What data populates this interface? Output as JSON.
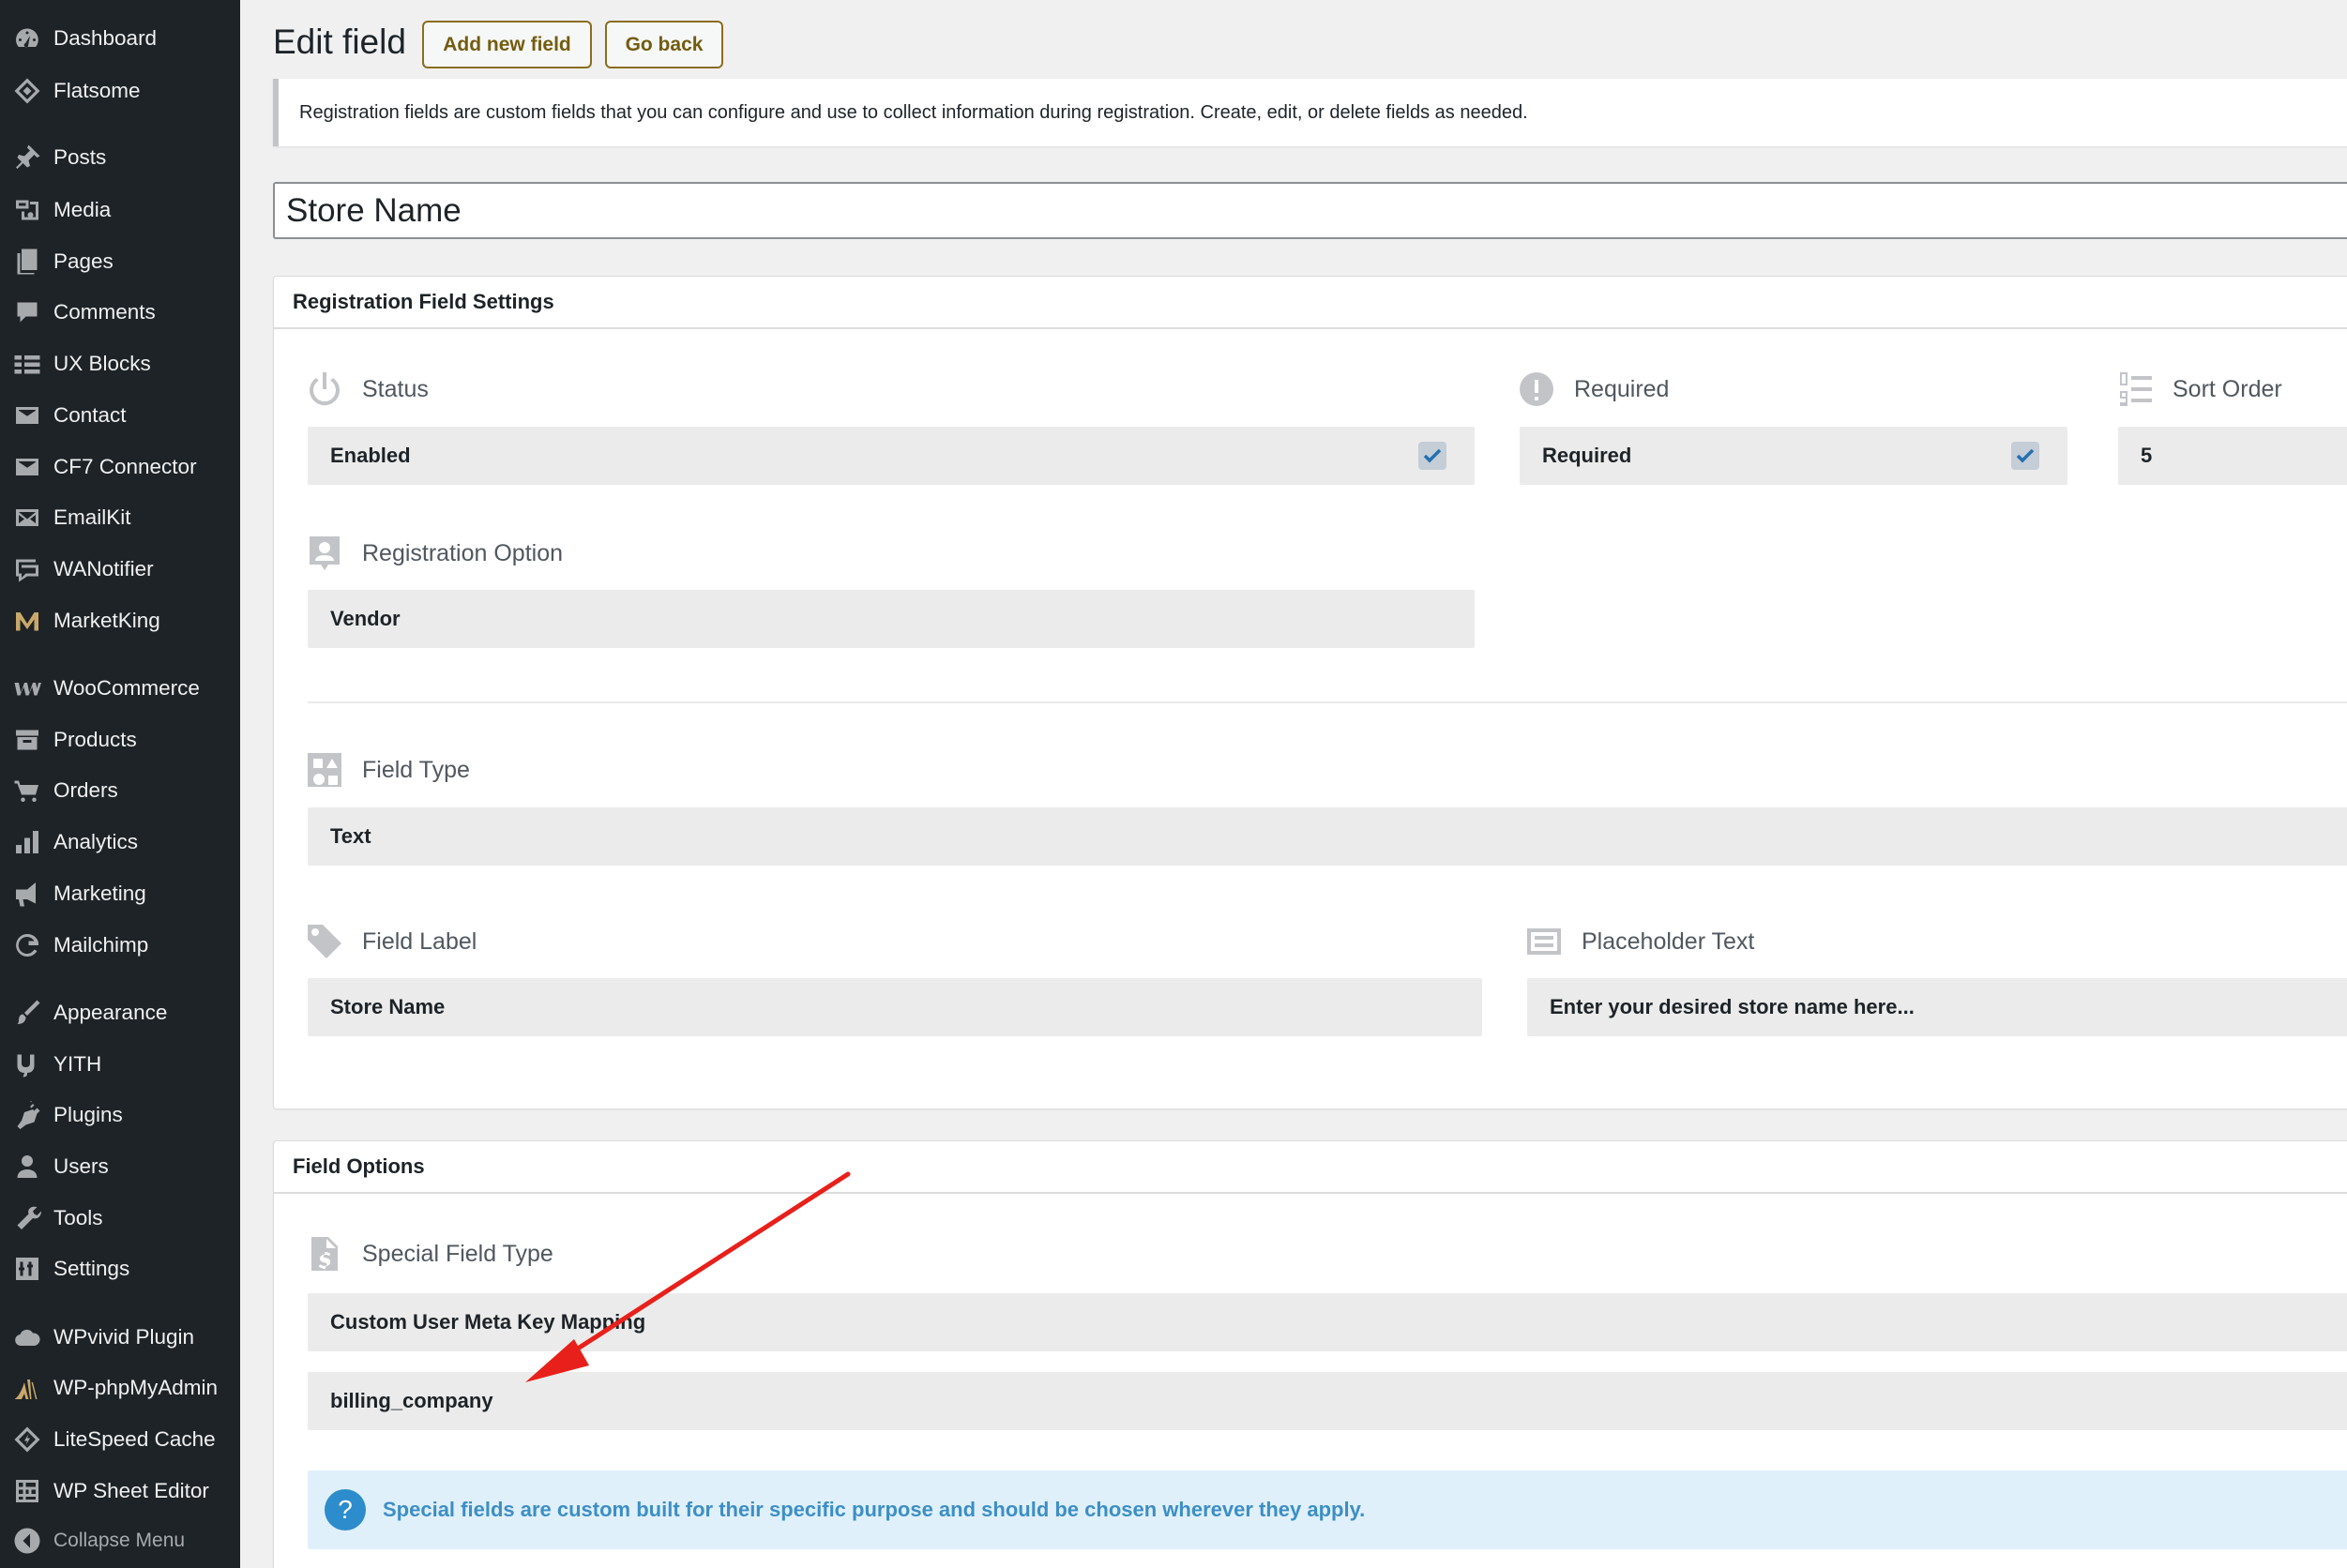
{
  "sidebar": {
    "items": [
      {
        "label": "Dashboard",
        "icon": "dashboard-icon"
      },
      {
        "label": "Flatsome",
        "icon": "flatsome-icon"
      },
      {
        "label": "Posts",
        "icon": "pin-icon"
      },
      {
        "label": "Media",
        "icon": "media-icon"
      },
      {
        "label": "Pages",
        "icon": "pages-icon"
      },
      {
        "label": "Comments",
        "icon": "comment-icon"
      },
      {
        "label": "UX Blocks",
        "icon": "ux-blocks-icon"
      },
      {
        "label": "Contact",
        "icon": "mail-icon"
      },
      {
        "label": "CF7 Connector",
        "icon": "mail-icon"
      },
      {
        "label": "EmailKit",
        "icon": "emailkit-icon"
      },
      {
        "label": "WANotifier",
        "icon": "chat-icon"
      },
      {
        "label": "MarketKing",
        "icon": "marketking-icon"
      },
      {
        "label": "WooCommerce",
        "icon": "woocommerce-icon"
      },
      {
        "label": "Products",
        "icon": "archive-icon"
      },
      {
        "label": "Orders",
        "icon": "cart-icon"
      },
      {
        "label": "Analytics",
        "icon": "bar-chart-icon"
      },
      {
        "label": "Marketing",
        "icon": "megaphone-icon"
      },
      {
        "label": "Mailchimp",
        "icon": "mailchimp-icon"
      },
      {
        "label": "Appearance",
        "icon": "brush-icon"
      },
      {
        "label": "YITH",
        "icon": "yith-icon"
      },
      {
        "label": "Plugins",
        "icon": "plug-icon"
      },
      {
        "label": "Users",
        "icon": "user-icon"
      },
      {
        "label": "Tools",
        "icon": "wrench-icon"
      },
      {
        "label": "Settings",
        "icon": "settings-icon"
      },
      {
        "label": "WPvivid Plugin",
        "icon": "cloud-icon"
      },
      {
        "label": "WP-phpMyAdmin",
        "icon": "phpmyadmin-icon"
      },
      {
        "label": "LiteSpeed Cache",
        "icon": "litespeed-icon"
      },
      {
        "label": "WP Sheet Editor",
        "icon": "sheet-icon"
      },
      {
        "label": "Collapse Menu",
        "icon": "collapse-icon"
      }
    ]
  },
  "header": {
    "title": "Edit field",
    "add_new_label": "Add new field",
    "go_back_label": "Go back"
  },
  "notice": {
    "text": "Registration fields are custom fields that you can configure and use to collect information during registration. Create, edit, or delete fields as needed."
  },
  "field_title": "Store Name",
  "settings_panel": {
    "title": "Registration Field Settings",
    "status": {
      "label": "Status",
      "value": "Enabled",
      "checked": true
    },
    "required": {
      "label": "Required",
      "value": "Required",
      "checked": true
    },
    "sort_order": {
      "label": "Sort Order",
      "value": "5"
    },
    "registration_option": {
      "label": "Registration Option",
      "value": "Vendor"
    },
    "field_type": {
      "label": "Field Type",
      "value": "Text"
    },
    "field_label": {
      "label": "Field Label",
      "value": "Store Name"
    },
    "placeholder_text": {
      "label": "Placeholder Text",
      "value": "Enter your desired store name here..."
    }
  },
  "options_panel": {
    "title": "Field Options",
    "special_field_type": {
      "label": "Special Field Type",
      "value": "Custom User Meta Key Mapping"
    },
    "meta_key": {
      "value": "billing_company"
    },
    "info": {
      "icon": "?",
      "text": "Special fields are custom built for their specific purpose and should be chosen wherever they apply."
    }
  },
  "colors": {
    "sidebar_bg": "#1d2327",
    "button_gold": "#8a6d1d",
    "info_blue": "#3c8fc5",
    "checkbox_blue": "#2271b1",
    "annotation_arrow": "#e8201b"
  }
}
